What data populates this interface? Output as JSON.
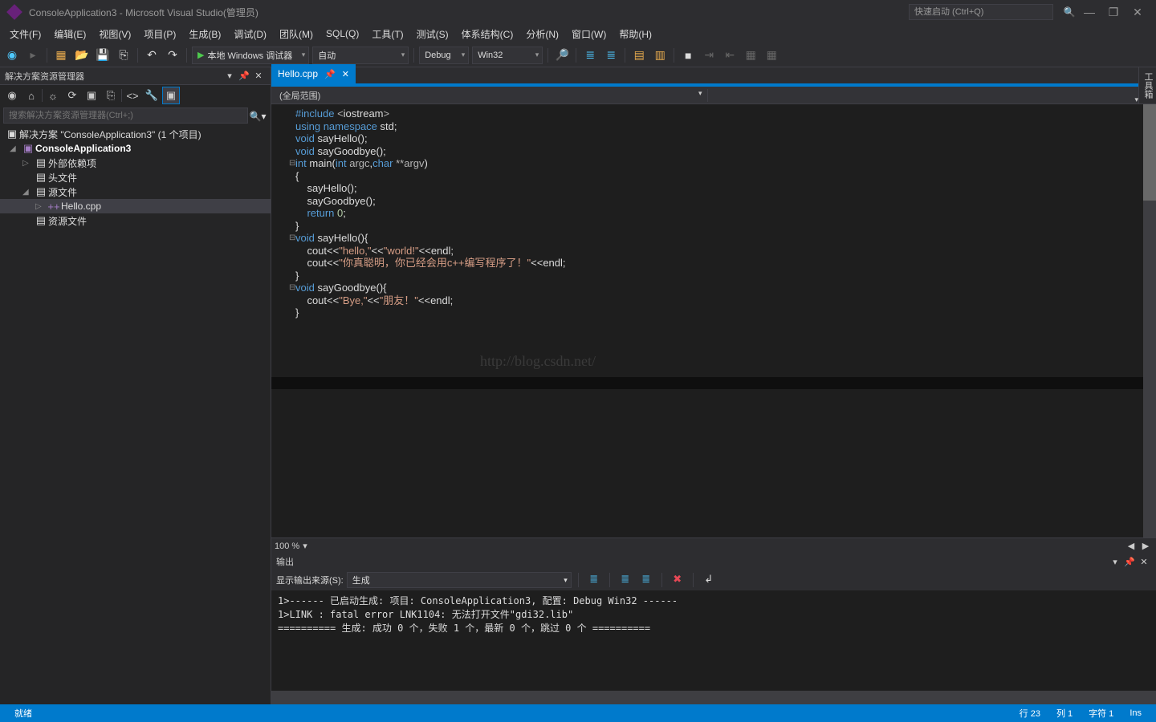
{
  "title": "ConsoleApplication3 - Microsoft Visual Studio(管理员)",
  "quick_launch": "快速启动 (Ctrl+Q)",
  "menus": [
    "文件(F)",
    "编辑(E)",
    "视图(V)",
    "项目(P)",
    "生成(B)",
    "调试(D)",
    "团队(M)",
    "SQL(Q)",
    "工具(T)",
    "测试(S)",
    "体系结构(C)",
    "分析(N)",
    "窗口(W)",
    "帮助(H)"
  ],
  "toolbar": {
    "debugger_label": "本地 Windows 调试器",
    "config_auto": "自动",
    "config_debug": "Debug",
    "config_platform": "Win32"
  },
  "solution_explorer": {
    "title": "解决方案资源管理器",
    "search_placeholder": "搜索解决方案资源管理器(Ctrl+;)",
    "root": "解决方案 \"ConsoleApplication3\" (1 个项目)",
    "project": "ConsoleApplication3",
    "nodes": {
      "ext": "外部依赖项",
      "headers": "头文件",
      "sources": "源文件",
      "hello": "Hello.cpp",
      "resources": "资源文件"
    }
  },
  "editor": {
    "tab": "Hello.cpp",
    "scope": "(全局范围)",
    "zoom": "100 %",
    "watermark": "http://blog.csdn.net/",
    "code_lines": [
      {
        "t": "#include <iostream>",
        "c": [
          "kw",
          "",
          "op",
          "id",
          "op"
        ]
      },
      {
        "raw": true,
        "html": "<span class='kw'>using</span> <span class='kw'>namespace</span> <span class='id'>std</span>;"
      },
      {
        "raw": true,
        "html": ""
      },
      {
        "raw": true,
        "html": ""
      },
      {
        "raw": true,
        "html": "<span class='kw'>void</span> <span class='id'>sayHello</span>();"
      },
      {
        "raw": true,
        "html": "<span class='kw'>void</span> <span class='id'>sayGoodbye</span>();"
      },
      {
        "raw": true,
        "html": "<span class='kw'>int</span> <span class='id'>main</span>(<span class='kw'>int</span> <span class='op'>argc</span>,<span class='kw'>char</span> <span class='op'>**argv</span>)",
        "fold": true
      },
      {
        "raw": true,
        "html": "{"
      },
      {
        "raw": true,
        "html": "    <span class='id'>sayHello</span>();"
      },
      {
        "raw": true,
        "html": "    <span class='id'>sayGoodbye</span>();"
      },
      {
        "raw": true,
        "html": "    <span class='kw'>return</span> <span class='num'>0</span>;"
      },
      {
        "raw": true,
        "html": "}"
      },
      {
        "raw": true,
        "html": "<span class='kw'>void</span> <span class='id'>sayHello</span>(){",
        "fold": true
      },
      {
        "raw": true,
        "html": "    <span class='id'>cout</span>&lt;&lt;<span class='str'>\"hello,\"</span>&lt;&lt;<span class='str'>\"world!\"</span>&lt;&lt;<span class='id'>endl</span>;"
      },
      {
        "raw": true,
        "html": "    <span class='id'>cout</span>&lt;&lt;<span class='str'>\"你真聪明，你已经会用c++编写程序了！\"</span>&lt;&lt;<span class='id'>endl</span>;"
      },
      {
        "raw": true,
        "html": "}"
      },
      {
        "raw": true,
        "html": ""
      },
      {
        "raw": true,
        "html": "<span class='kw'>void</span> <span class='id'>sayGoodbye</span>(){",
        "fold": true
      },
      {
        "raw": true,
        "html": "    <span class='id'>cout</span>&lt;&lt;<span class='str'>\"Bye,\"</span>&lt;&lt;<span class='str'>\"朋友！\"</span>&lt;&lt;<span class='id'>endl</span>;"
      },
      {
        "raw": true,
        "html": "}"
      }
    ]
  },
  "output": {
    "title": "输出",
    "src_label": "显示输出来源(S):",
    "src_value": "生成",
    "lines": [
      "1>------ 已启动生成: 项目: ConsoleApplication3, 配置: Debug Win32 ------",
      "1>LINK : fatal error LNK1104: 无法打开文件\"gdi32.lib\"",
      "========== 生成: 成功 0 个，失败 1 个，最新 0 个，跳过 0 个 =========="
    ]
  },
  "status": {
    "ready": "就绪",
    "line": "行 23",
    "col": "列 1",
    "char": "字符 1",
    "ins": "Ins"
  },
  "right_tab": "工具箱"
}
